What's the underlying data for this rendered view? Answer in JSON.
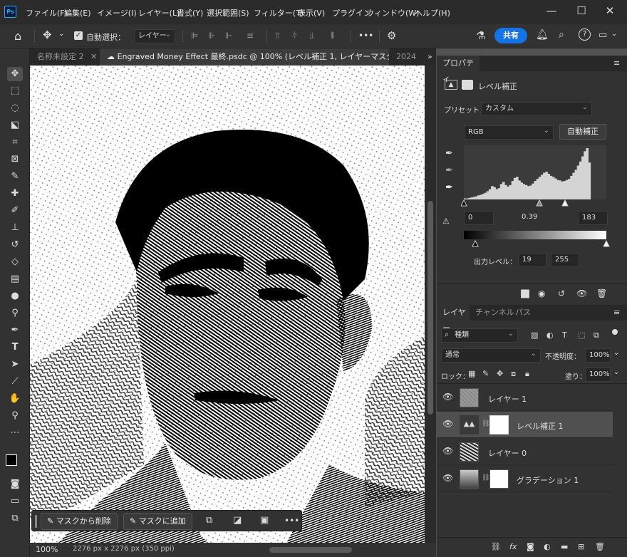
{
  "app": {
    "logo": "Ps"
  },
  "menu": [
    "ファイル(F)",
    "編集(E)",
    "イメージ(I)",
    "レイヤー(L)",
    "書式(Y)",
    "選択範囲(S)",
    "フィルター(T)",
    "表示(V)",
    "プラグイン",
    "ウィンドウ(W)",
    "ヘルプ(H)"
  ],
  "window_controls": {
    "minimize": "—",
    "maximize": "☐",
    "close": "✕"
  },
  "options": {
    "auto_select_label": "自動選択：",
    "auto_select_target": "レイヤー",
    "more": "•••",
    "share": "共有"
  },
  "tabs": [
    {
      "label": "名称未設定 2",
      "close": "✕",
      "active": false
    },
    {
      "label": "Engraved Money Effect 最終.psdc @ 100% (レベル補正 1, レイヤーマスク/8) *",
      "close": "✕",
      "active": true
    },
    {
      "label": "2024",
      "close": "",
      "active": false
    }
  ],
  "tabs_overflow": "»",
  "properties": {
    "tab": "プロパティ",
    "adjust_title": "レベル補正",
    "preset_label": "プリセット：",
    "preset_value": "カスタム",
    "channel": "RGB",
    "auto_button": "自動補正",
    "input_black": "0",
    "input_mid": "0.39",
    "input_white": "183",
    "output_label": "出力レベル：",
    "output_black": "19",
    "output_white": "255",
    "histogram": [
      2,
      2,
      3,
      4,
      5,
      6,
      8,
      9,
      11,
      13,
      16,
      20,
      26,
      24,
      20,
      22,
      30,
      34,
      28,
      25,
      28,
      36,
      42,
      44,
      37,
      33,
      30,
      28,
      26,
      27,
      31,
      36,
      40,
      44,
      48,
      52,
      54,
      50,
      46,
      44,
      41,
      38,
      37,
      35,
      36,
      38,
      40,
      46,
      52,
      58,
      66,
      74,
      84,
      94,
      100,
      72,
      0,
      0,
      0,
      0,
      0,
      0,
      0
    ]
  },
  "layers": {
    "tabs": [
      "レイヤー",
      "チャンネル",
      "パス"
    ],
    "filter": "種類",
    "blend": "通常",
    "opacity_label": "不透明度：",
    "opacity": "100%",
    "lock_label": "ロック：",
    "fill_label": "塗り：",
    "fill": "100%",
    "items": [
      {
        "name": "レイヤー 1",
        "selected": false
      },
      {
        "name": "レベル補正 1",
        "selected": true
      },
      {
        "name": "レイヤー 0",
        "selected": false
      },
      {
        "name": "グラデーション 1",
        "selected": false
      }
    ]
  },
  "context_bar": {
    "remove": "マスクから削除",
    "add": "マスクに追加",
    "more": "•••"
  },
  "status": {
    "zoom": "100%",
    "doc": "2276 px x 2276 px (350 ppi)"
  },
  "colors": {
    "accent": "#1473e6",
    "panel": "#323232",
    "bg": "#535353",
    "menubar": "#2b2b2b"
  }
}
